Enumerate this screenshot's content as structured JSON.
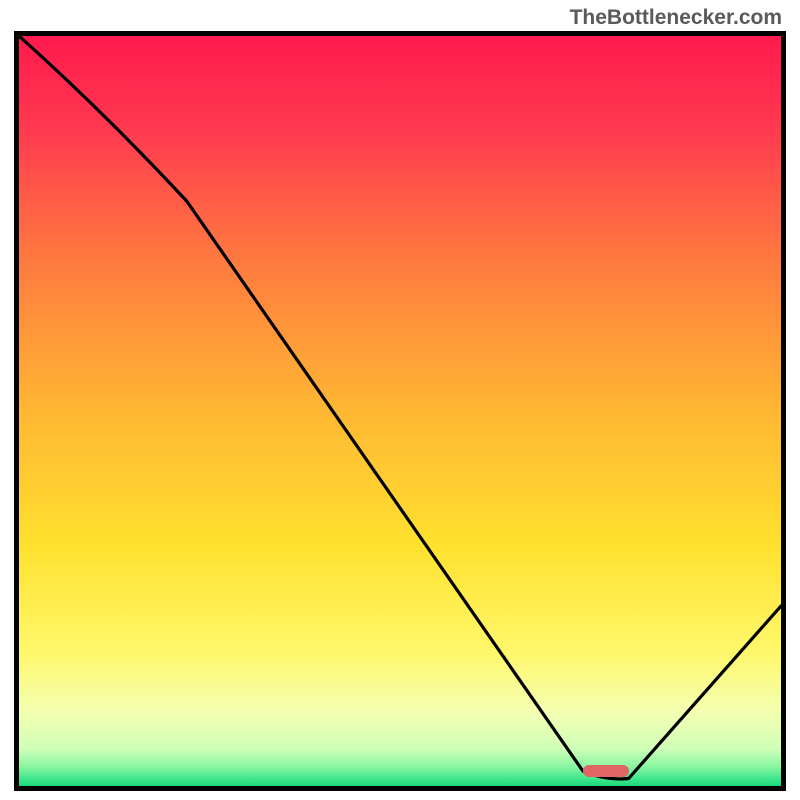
{
  "watermark": "TheBottlenecker.com",
  "chart_data": {
    "type": "line",
    "title": "",
    "xlabel": "",
    "ylabel": "",
    "xlim": [
      0,
      100
    ],
    "ylim": [
      0,
      100
    ],
    "x": [
      0,
      22,
      74,
      80,
      100
    ],
    "values": [
      100,
      78,
      2,
      1,
      24
    ],
    "marker": {
      "x": 77,
      "y": 2,
      "color": "#e06666",
      "width_pct": 6,
      "height_pct": 1.5
    },
    "gradient_stops": [
      {
        "offset": 0,
        "color": "#ff1a4d"
      },
      {
        "offset": 0.12,
        "color": "#ff3850"
      },
      {
        "offset": 0.3,
        "color": "#ff7a3f"
      },
      {
        "offset": 0.5,
        "color": "#ffb733"
      },
      {
        "offset": 0.68,
        "color": "#ffe12e"
      },
      {
        "offset": 0.82,
        "color": "#fff76a"
      },
      {
        "offset": 0.9,
        "color": "#f4ffb0"
      },
      {
        "offset": 0.95,
        "color": "#cfffb8"
      },
      {
        "offset": 0.975,
        "color": "#87f5a0"
      },
      {
        "offset": 0.99,
        "color": "#3fe68a"
      },
      {
        "offset": 1.0,
        "color": "#1dd97a"
      }
    ]
  }
}
